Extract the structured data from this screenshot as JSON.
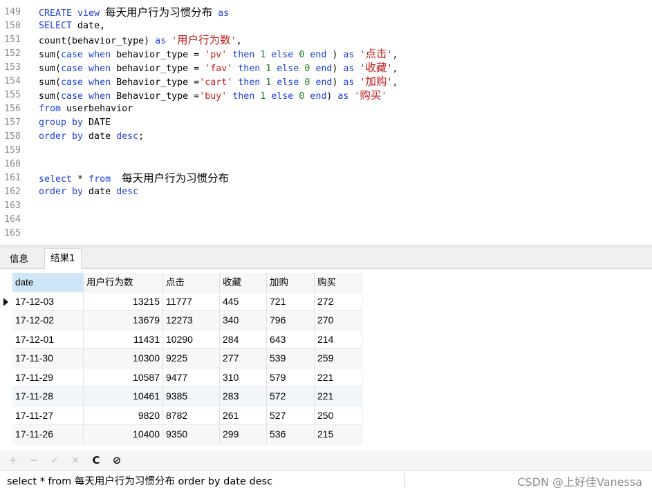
{
  "editor": {
    "lines": [
      {
        "n": "149",
        "parts": [
          [
            "kw",
            "CREATE view "
          ],
          [
            "cjk",
            "每天用户行为习惯分布"
          ],
          [
            "kw",
            " as"
          ]
        ]
      },
      {
        "n": "150",
        "parts": [
          [
            "kw",
            "SELECT"
          ],
          [
            "t",
            " date,"
          ]
        ]
      },
      {
        "n": "151",
        "parts": [
          [
            "t",
            "count(behavior_type) "
          ],
          [
            "kw",
            "as"
          ],
          [
            "str",
            " '"
          ],
          [
            "str cjk",
            "用户行为数"
          ],
          [
            "str",
            "'"
          ],
          [
            "t",
            ","
          ]
        ]
      },
      {
        "n": "152",
        "parts": [
          [
            "t",
            "sum("
          ],
          [
            "kw",
            "case when"
          ],
          [
            "t",
            " behavior_type = "
          ],
          [
            "str",
            "'pv'"
          ],
          [
            "kw",
            " then "
          ],
          [
            "num",
            "1"
          ],
          [
            "kw",
            " else "
          ],
          [
            "num",
            "0"
          ],
          [
            "kw",
            " end"
          ],
          [
            "t",
            " ) "
          ],
          [
            "kw",
            "as"
          ],
          [
            "str",
            " '"
          ],
          [
            "str cjk",
            "点击"
          ],
          [
            "str",
            "'"
          ],
          [
            "t",
            ","
          ]
        ]
      },
      {
        "n": "153",
        "parts": [
          [
            "t",
            "sum("
          ],
          [
            "kw",
            "case when"
          ],
          [
            "t",
            " behavior_type = "
          ],
          [
            "str",
            "'fav'"
          ],
          [
            "kw",
            " then "
          ],
          [
            "num",
            "1"
          ],
          [
            "kw",
            " else "
          ],
          [
            "num",
            "0"
          ],
          [
            "kw",
            " end"
          ],
          [
            "t",
            ") "
          ],
          [
            "kw",
            "as"
          ],
          [
            "str",
            " '"
          ],
          [
            "str cjk",
            "收藏"
          ],
          [
            "str",
            "'"
          ],
          [
            "t",
            ","
          ]
        ]
      },
      {
        "n": "154",
        "parts": [
          [
            "t",
            "sum("
          ],
          [
            "kw",
            "case when"
          ],
          [
            "t",
            " Behavior_type ="
          ],
          [
            "str",
            "'cart'"
          ],
          [
            "kw",
            " then "
          ],
          [
            "num",
            "1"
          ],
          [
            "kw",
            " else "
          ],
          [
            "num",
            "0"
          ],
          [
            "kw",
            " end"
          ],
          [
            "t",
            ") "
          ],
          [
            "kw",
            "as"
          ],
          [
            "str",
            " '"
          ],
          [
            "str cjk",
            "加购"
          ],
          [
            "str",
            "'"
          ],
          [
            "t",
            ","
          ]
        ]
      },
      {
        "n": "155",
        "parts": [
          [
            "t",
            "sum("
          ],
          [
            "kw",
            "case when"
          ],
          [
            "t",
            " Behavior_type ="
          ],
          [
            "str",
            "'buy'"
          ],
          [
            "kw",
            " then "
          ],
          [
            "num",
            "1"
          ],
          [
            "kw",
            " else "
          ],
          [
            "num",
            "0"
          ],
          [
            "kw",
            " end"
          ],
          [
            "t",
            ") "
          ],
          [
            "kw",
            "as"
          ],
          [
            "str",
            " '"
          ],
          [
            "str cjk",
            "购买"
          ],
          [
            "str",
            "'"
          ]
        ]
      },
      {
        "n": "156",
        "parts": [
          [
            "kw",
            "from"
          ],
          [
            "t",
            " userbehavior"
          ]
        ]
      },
      {
        "n": "157",
        "parts": [
          [
            "kw",
            "group by"
          ],
          [
            "t",
            " DATE"
          ]
        ]
      },
      {
        "n": "158",
        "parts": [
          [
            "kw",
            "order by"
          ],
          [
            "t",
            " date "
          ],
          [
            "kw",
            "desc"
          ],
          [
            "t",
            ";"
          ]
        ]
      },
      {
        "n": "159",
        "parts": []
      },
      {
        "n": "160",
        "parts": []
      },
      {
        "n": "161",
        "parts": [
          [
            "kw",
            "select"
          ],
          [
            "t",
            " * "
          ],
          [
            "kw",
            "from"
          ],
          [
            "t",
            "  "
          ],
          [
            "cjk",
            "每天用户行为习惯分布"
          ]
        ]
      },
      {
        "n": "162",
        "parts": [
          [
            "kw",
            "order by"
          ],
          [
            "t",
            " date "
          ],
          [
            "kw",
            "desc"
          ]
        ]
      },
      {
        "n": "163",
        "parts": []
      },
      {
        "n": "164",
        "parts": []
      },
      {
        "n": "165",
        "parts": []
      }
    ]
  },
  "tabs": [
    {
      "label": "信息",
      "active": false
    },
    {
      "label": "结果1",
      "active": true
    }
  ],
  "grid": {
    "columns": [
      "date",
      "用户行为数",
      "点击",
      "收藏",
      "加购",
      "购买"
    ],
    "rows": [
      [
        "17-12-03",
        "13215",
        "11777",
        "445",
        "721",
        "272"
      ],
      [
        "17-12-02",
        "13679",
        "12273",
        "340",
        "796",
        "270"
      ],
      [
        "17-12-01",
        "11431",
        "10290",
        "284",
        "643",
        "214"
      ],
      [
        "17-11-30",
        "10300",
        "9225",
        "277",
        "539",
        "259"
      ],
      [
        "17-11-29",
        "10587",
        "9477",
        "310",
        "579",
        "221"
      ],
      [
        "17-11-28",
        "10461",
        "9385",
        "283",
        "572",
        "221"
      ],
      [
        "17-11-27",
        "9820",
        "8782",
        "261",
        "527",
        "250"
      ],
      [
        "17-11-26",
        "10400",
        "9350",
        "299",
        "536",
        "215"
      ]
    ]
  },
  "toolbar": {
    "buttons": [
      {
        "name": "add-record-icon",
        "glyph": "+",
        "enabled": false
      },
      {
        "name": "delete-record-icon",
        "glyph": "−",
        "enabled": false
      },
      {
        "name": "apply-changes-icon",
        "glyph": "✓",
        "enabled": false
      },
      {
        "name": "discard-changes-icon",
        "glyph": "✕",
        "enabled": false
      },
      {
        "name": "refresh-icon",
        "glyph": "C",
        "enabled": true
      },
      {
        "name": "stop-icon",
        "glyph": "⊘",
        "enabled": true
      }
    ]
  },
  "status": {
    "query_text": "select * from  每天用户行为习惯分布 order by date desc",
    "watermark": "CSDN @上好佳Vanessa"
  }
}
